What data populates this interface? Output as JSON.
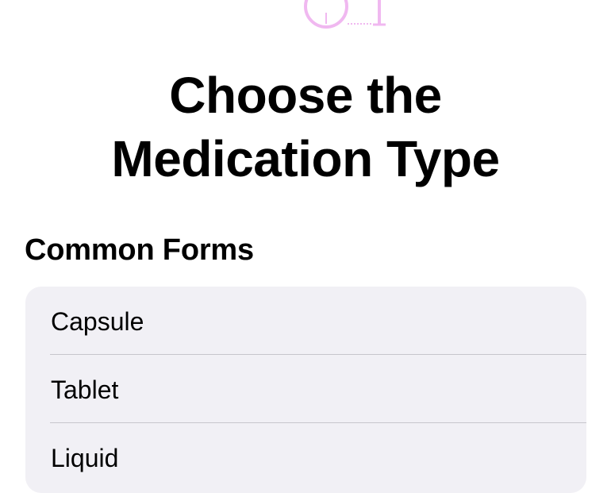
{
  "header": {
    "title_line1": "Choose the",
    "title_line2": "Medication Type",
    "art_icon": "pill-illustration-icon",
    "art_color": "#f0b8f0"
  },
  "section": {
    "heading": "Common Forms"
  },
  "list": {
    "items": [
      {
        "label": "Capsule"
      },
      {
        "label": "Tablet"
      },
      {
        "label": "Liquid"
      }
    ]
  },
  "colors": {
    "background": "#ffffff",
    "card": "#f1f0f5",
    "separator": "#c7c6cc",
    "text": "#000000"
  }
}
